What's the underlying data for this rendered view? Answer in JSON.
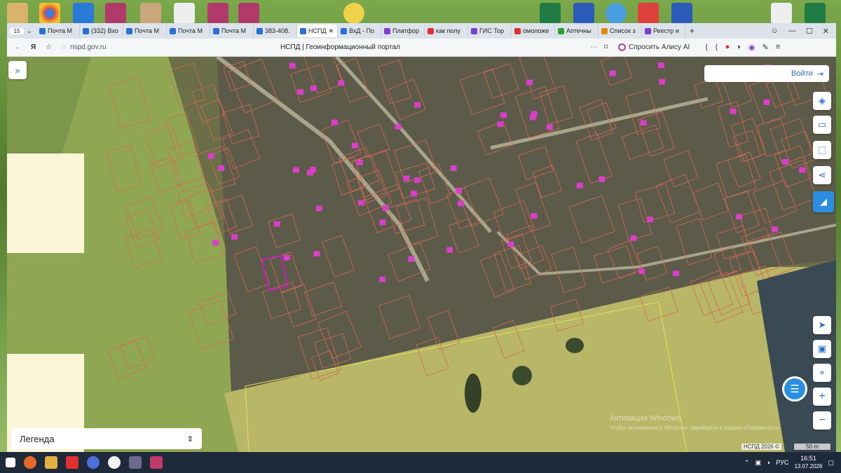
{
  "browser": {
    "tab_count": "15",
    "tabs": [
      {
        "label": "Почта M",
        "color": "#2a6fd6"
      },
      {
        "label": "(332) Вхо",
        "color": "#2a6fd6"
      },
      {
        "label": "Почта M",
        "color": "#2a6fd6"
      },
      {
        "label": "Почта M",
        "color": "#2a6fd6"
      },
      {
        "label": "Почта M",
        "color": "#2a6fd6"
      },
      {
        "label": "383-408.",
        "color": "#2a6fd6"
      },
      {
        "label": "НСПД",
        "color": "#2a6fd6"
      },
      {
        "label": "ВхД - По",
        "color": "#2a6fd6"
      },
      {
        "label": "Платфор",
        "color": "#7a3fd0"
      },
      {
        "label": "как полу",
        "color": "#e03030"
      },
      {
        "label": "ГИС Тор",
        "color": "#7a3fd0"
      },
      {
        "label": "омоложе",
        "color": "#e03030"
      },
      {
        "label": "Аптечны",
        "color": "#2ca02c"
      },
      {
        "label": "Список з",
        "color": "#e08a00"
      },
      {
        "label": "Реестр и",
        "color": "#7a3fd0"
      }
    ],
    "url": "nspd.gov.ru",
    "page_title": "НСПД | Геоинформационный портал",
    "alice_label": "Спросить Алису AI"
  },
  "map": {
    "login_label": "Войти",
    "legend_label": "Легенда",
    "attribution": "НСПД 2026 ©",
    "scale_label": "50 m",
    "watermark_line1": "Активация Windows",
    "watermark_line2": "Чтобы активировать Windows, перейдите в раздел «Параметры»."
  },
  "taskbar": {
    "lang": "РУС",
    "time": "16:51",
    "date": "13.07.2026"
  }
}
